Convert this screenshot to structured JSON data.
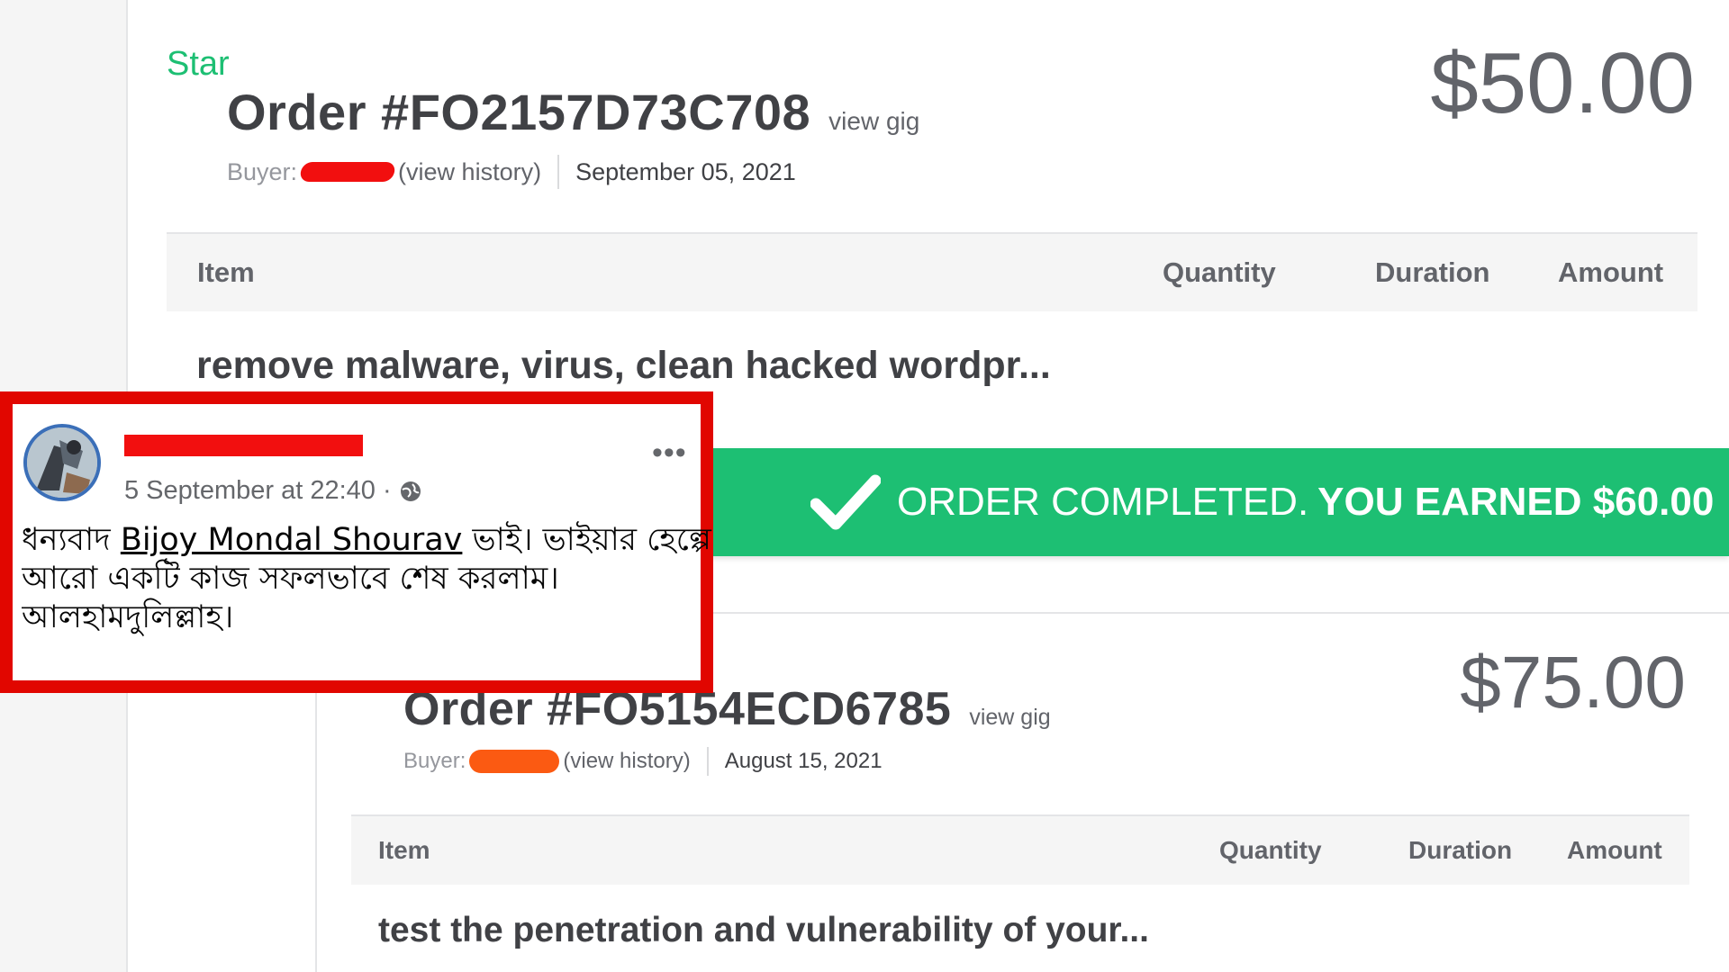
{
  "order1": {
    "seller_level": "Star",
    "title": "Order #FO2157D73C708",
    "view_gig": "view gig",
    "price": "$50.00",
    "buyer_label": "Buyer:",
    "view_history": "(view history)",
    "date": "September 05, 2021",
    "columns": {
      "item": "Item",
      "quantity": "Quantity",
      "duration": "Duration",
      "amount": "Amount"
    },
    "item_name": "remove malware, virus, clean hacked wordpr..."
  },
  "banner": {
    "text": "ORDER COMPLETED.",
    "earned": "YOU EARNED $60.00",
    "color": "#1dbf73",
    "icon": "checkmark-icon"
  },
  "order2": {
    "title": "Order #FO5154ECD6785",
    "view_gig": "view gig",
    "price": "$75.00",
    "buyer_label": "Buyer:",
    "view_history": "(view history)",
    "date": "August 15, 2021",
    "columns": {
      "item": "Item",
      "quantity": "Quantity",
      "duration": "Duration",
      "amount": "Amount"
    },
    "item_name": "test the penetration and vulnerability of your..."
  },
  "facebook_post": {
    "timestamp": "5 September at 22:40 ·",
    "more": "•••",
    "text_prefix": "ধন্যবাদ ",
    "mention": "Bijoy Mondal Shourav",
    "text_suffix": " ভাই। ভাইয়ার হেল্পে",
    "line2": "আরো একটি কাজ সফলভাবে শেষ করলাম।",
    "line3": "আলহামদুলিল্লাহ।",
    "highlight_color": "#e10600",
    "icons": [
      "globe-icon",
      "more-options-icon"
    ]
  },
  "colors": {
    "fiverr_green": "#1dbf73",
    "redaction_red": "#f20f0f",
    "redaction_orange": "#fb5a12"
  }
}
